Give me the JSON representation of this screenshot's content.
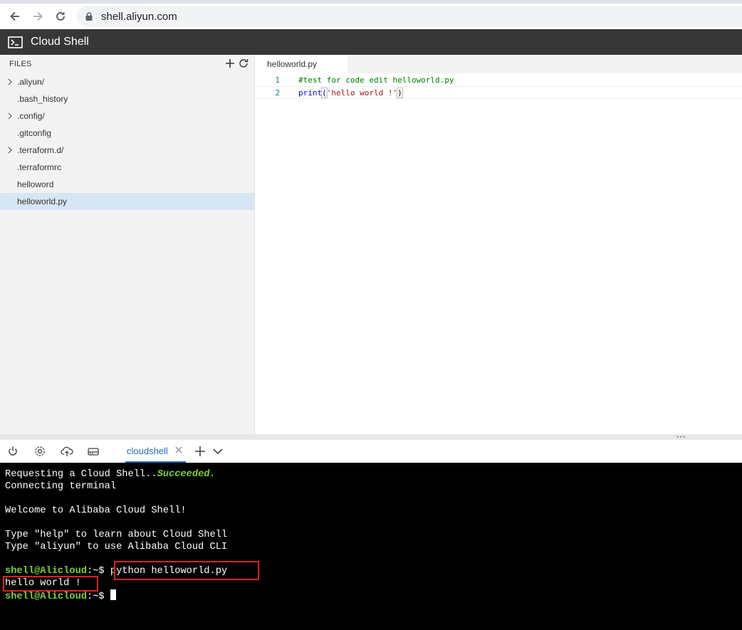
{
  "browser": {
    "url": "shell.aliyun.com"
  },
  "app": {
    "title": "Cloud Shell"
  },
  "sidebar": {
    "header": "FILES",
    "files": [
      {
        "name": ".aliyun/",
        "folder": true
      },
      {
        "name": ".bash_history",
        "folder": false
      },
      {
        "name": ".config/",
        "folder": true
      },
      {
        "name": ".gitconfig",
        "folder": false
      },
      {
        "name": ".terraform.d/",
        "folder": true
      },
      {
        "name": ".terraformrc",
        "folder": false
      },
      {
        "name": "helloword",
        "folder": false
      },
      {
        "name": "helloworld.py",
        "folder": false,
        "selected": true
      }
    ]
  },
  "editor": {
    "tab": "helloworld.py",
    "lines": [
      {
        "num": "1",
        "comment": "#test for code edit helloworld.py"
      },
      {
        "num": "2",
        "func": "print",
        "open": "(",
        "string": "'hello world !'",
        "close": ")"
      }
    ]
  },
  "terminal_tab": {
    "label": "cloudshell"
  },
  "terminal": {
    "line1_prefix": "Requesting a Cloud Shell..",
    "line1_status": "Succeeded.",
    "line2": "Connecting terminal",
    "line3": "Welcome to Alibaba Cloud Shell!",
    "line4": "Type \"help\" to learn about Cloud Shell",
    "line5": "Type \"aliyun\" to use Alibaba Cloud CLI",
    "prompt_user": "shell@Alicloud",
    "prompt_sep": ":~$",
    "command": "python helloworld.py",
    "output": "hello world !"
  },
  "colors": {
    "header_bg": "#373737",
    "accent": "#1f6bbd",
    "prompt_green": "#7bd134",
    "highlight_red": "#e02020"
  }
}
